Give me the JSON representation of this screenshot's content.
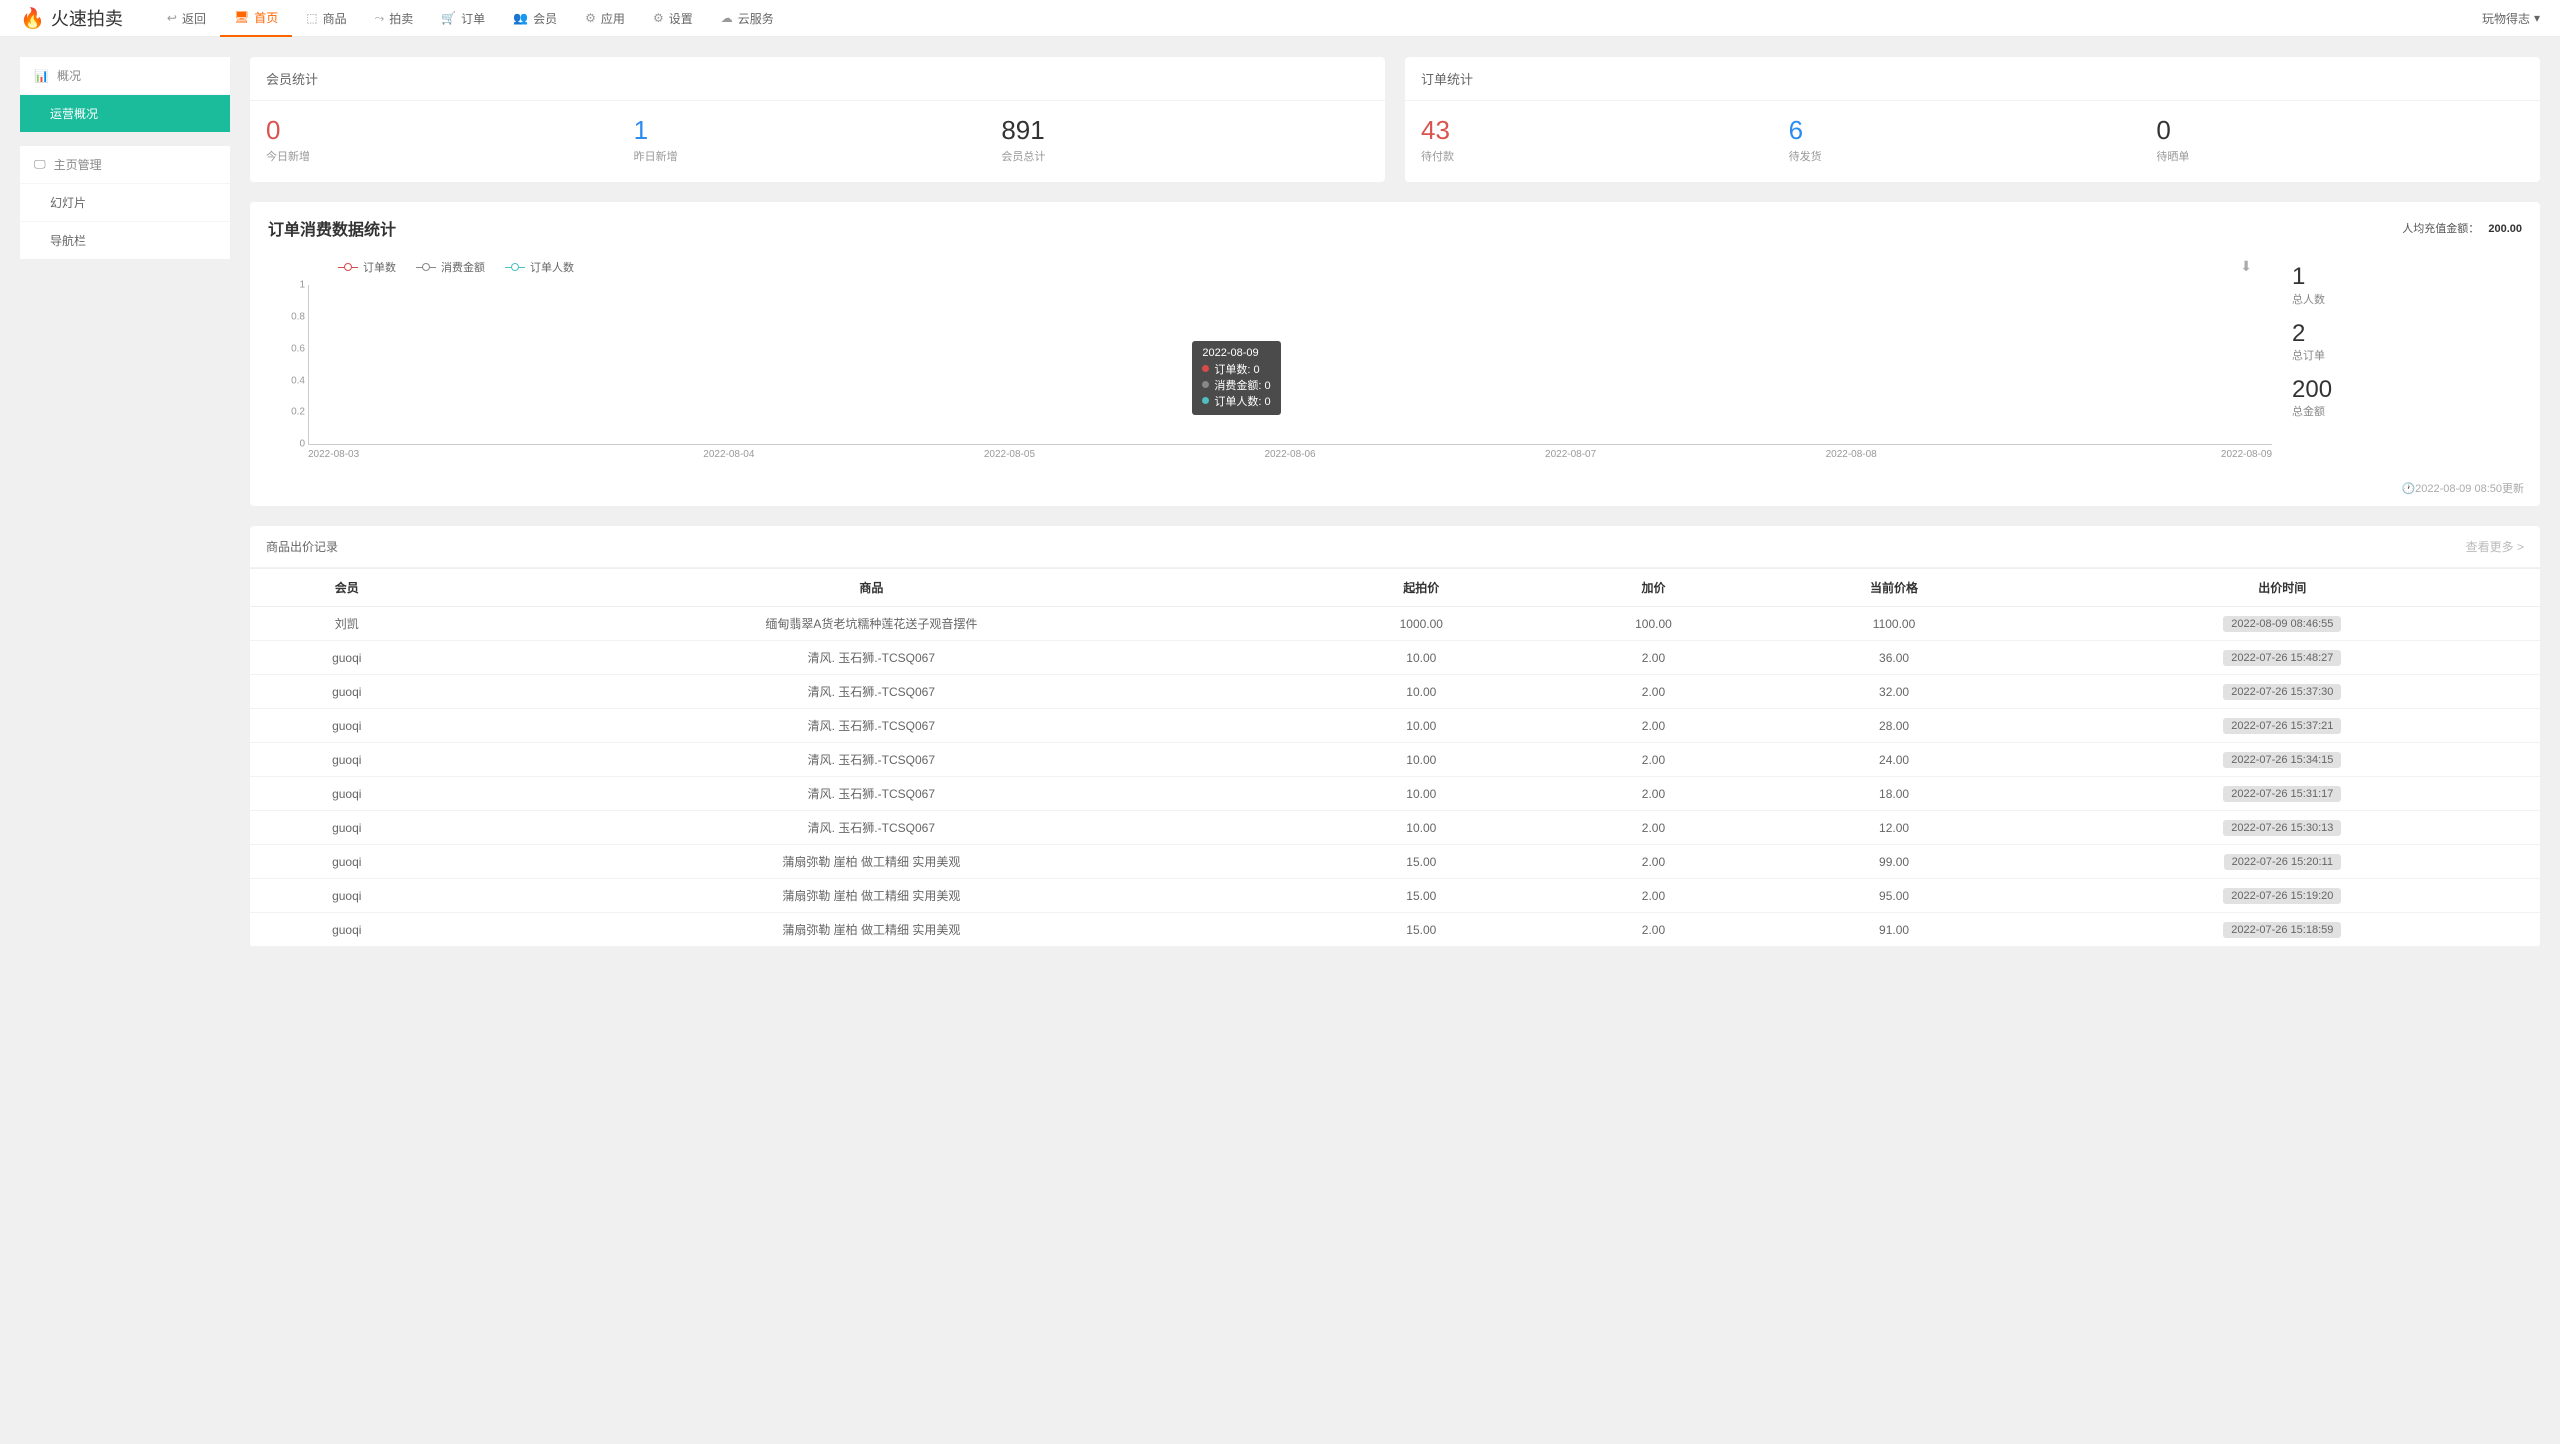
{
  "brand": "火速拍卖",
  "nav": {
    "back": "返回",
    "home": "首页",
    "product": "商品",
    "auction": "拍卖",
    "order": "订单",
    "member": "会员",
    "app": "应用",
    "setting": "设置",
    "cloud": "云服务",
    "user_dropdown": "玩物得志"
  },
  "sidebar": {
    "overview": "概况",
    "operation_overview": "运营概况",
    "home_manage": "主页管理",
    "slideshow": "幻灯片",
    "navbar": "导航栏"
  },
  "member_stats": {
    "title": "会员统计",
    "today_new": {
      "value": "0",
      "label": "今日新增"
    },
    "yesterday_new": {
      "value": "1",
      "label": "昨日新增"
    },
    "total": {
      "value": "891",
      "label": "会员总计"
    }
  },
  "order_stats": {
    "title": "订单统计",
    "pending_pay": {
      "value": "43",
      "label": "待付款"
    },
    "pending_ship": {
      "value": "6",
      "label": "待发货"
    },
    "pending_review": {
      "value": "0",
      "label": "待晒单"
    }
  },
  "chart_panel": {
    "title": "订单消费数据统计",
    "avg_recharge_label": "人均充值金额：",
    "avg_recharge_value": "200.00",
    "legend": {
      "orders": "订单数",
      "amount": "消费金额",
      "persons": "订单人数"
    },
    "side": {
      "total_persons": {
        "value": "1",
        "label": "总人数"
      },
      "total_orders": {
        "value": "2",
        "label": "总订单"
      },
      "total_amount": {
        "value": "200",
        "label": "总金额"
      }
    },
    "footer_time": "2022-08-09 08:50更新",
    "tooltip": {
      "date": "2022-08-09",
      "row1": "订单数: 0",
      "row2": "消费金额: 0",
      "row3": "订单人数: 0"
    }
  },
  "chart_data": {
    "type": "line",
    "categories": [
      "2022-08-03",
      "2022-08-04",
      "2022-08-05",
      "2022-08-06",
      "2022-08-07",
      "2022-08-08",
      "2022-08-09"
    ],
    "series": [
      {
        "name": "订单数",
        "values": [
          0,
          0,
          0,
          0,
          0,
          0,
          0
        ],
        "color": "#d94a4a"
      },
      {
        "name": "消费金额",
        "values": [
          0,
          0,
          0,
          0,
          0,
          0,
          0
        ],
        "color": "#888888"
      },
      {
        "name": "订单人数",
        "values": [
          0,
          0,
          0,
          0,
          0,
          0,
          0
        ],
        "color": "#4fbfbf"
      }
    ],
    "ylim": [
      0,
      1
    ],
    "yticks": [
      0,
      0.2,
      0.4,
      0.6,
      0.8,
      1
    ],
    "title": "订单消费数据统计",
    "xlabel": "",
    "ylabel": ""
  },
  "bid_table": {
    "title": "商品出价记录",
    "more": "查看更多 >",
    "headers": {
      "member": "会员",
      "product": "商品",
      "start_price": "起拍价",
      "increment": "加价",
      "current_price": "当前价格",
      "bid_time": "出价时间"
    },
    "rows": [
      {
        "member": "刘凯",
        "product": "缅甸翡翠A货老坑糯种莲花送子观音摆件",
        "start": "1000.00",
        "inc": "100.00",
        "current": "1100.00",
        "time": "2022-08-09 08:46:55"
      },
      {
        "member": "guoqi",
        "product": "清风. 玉石狮.-TCSQ067",
        "start": "10.00",
        "inc": "2.00",
        "current": "36.00",
        "time": "2022-07-26 15:48:27"
      },
      {
        "member": "guoqi",
        "product": "清风. 玉石狮.-TCSQ067",
        "start": "10.00",
        "inc": "2.00",
        "current": "32.00",
        "time": "2022-07-26 15:37:30"
      },
      {
        "member": "guoqi",
        "product": "清风. 玉石狮.-TCSQ067",
        "start": "10.00",
        "inc": "2.00",
        "current": "28.00",
        "time": "2022-07-26 15:37:21"
      },
      {
        "member": "guoqi",
        "product": "清风. 玉石狮.-TCSQ067",
        "start": "10.00",
        "inc": "2.00",
        "current": "24.00",
        "time": "2022-07-26 15:34:15"
      },
      {
        "member": "guoqi",
        "product": "清风. 玉石狮.-TCSQ067",
        "start": "10.00",
        "inc": "2.00",
        "current": "18.00",
        "time": "2022-07-26 15:31:17"
      },
      {
        "member": "guoqi",
        "product": "清风. 玉石狮.-TCSQ067",
        "start": "10.00",
        "inc": "2.00",
        "current": "12.00",
        "time": "2022-07-26 15:30:13"
      },
      {
        "member": "guoqi",
        "product": "蒲扇弥勒 崖柏 做工精细 实用美观",
        "start": "15.00",
        "inc": "2.00",
        "current": "99.00",
        "time": "2022-07-26 15:20:11"
      },
      {
        "member": "guoqi",
        "product": "蒲扇弥勒 崖柏 做工精细 实用美观",
        "start": "15.00",
        "inc": "2.00",
        "current": "95.00",
        "time": "2022-07-26 15:19:20"
      },
      {
        "member": "guoqi",
        "product": "蒲扇弥勒 崖柏 做工精细 实用美观",
        "start": "15.00",
        "inc": "2.00",
        "current": "91.00",
        "time": "2022-07-26 15:18:59"
      }
    ]
  }
}
